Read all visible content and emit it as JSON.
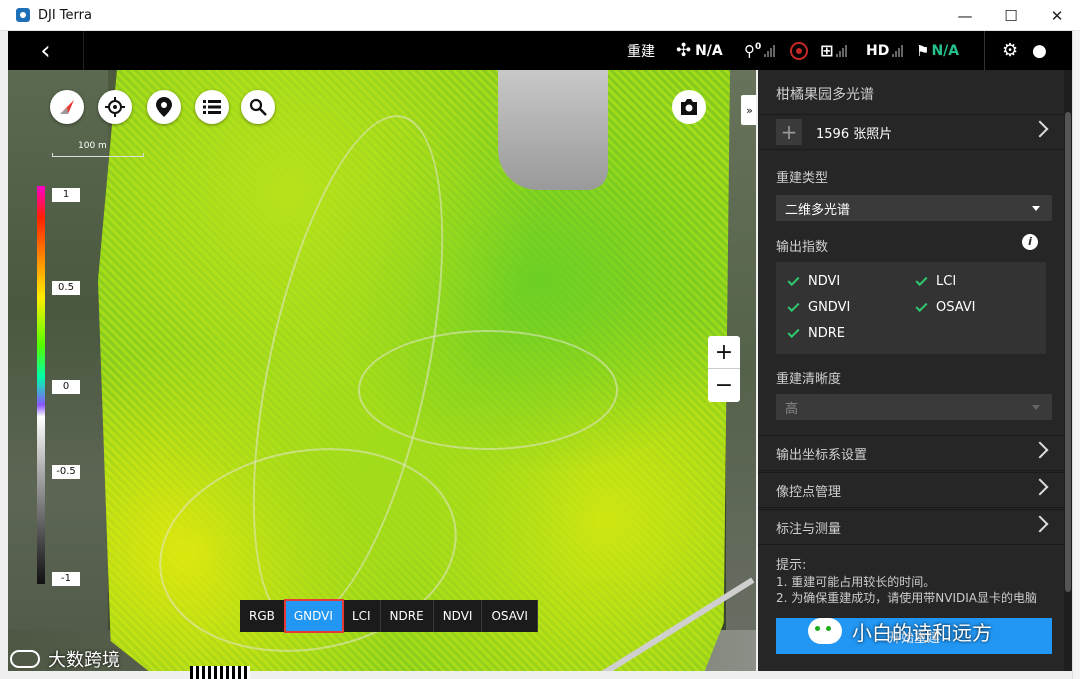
{
  "window": {
    "title": "DJI Terra",
    "controls": {
      "minimize": "—",
      "maximize": "☐",
      "close": "✕"
    }
  },
  "toolbar": {
    "back_icon": "‹",
    "rebuild_label": "重建",
    "aircraft_status": "N/A",
    "gps_count": "0",
    "hd_label": "HD",
    "rtk_status": "N/A"
  },
  "map": {
    "scale_label": "100 m",
    "legend": [
      "1",
      "0.5",
      "0",
      "-0.5",
      "-1"
    ],
    "index_tabs": [
      "RGB",
      "GNDVI",
      "LCI",
      "NDRE",
      "NDVI",
      "OSAVI"
    ],
    "active_index": "GNDVI",
    "zoom_in": "+",
    "zoom_out": "−",
    "collapse_icon": "»"
  },
  "panel": {
    "project_title": "柑橘果园多光谱",
    "photos": {
      "add_icon": "+",
      "label": "1596 张照片"
    },
    "rebuild_type": {
      "label": "重建类型",
      "value": "二维多光谱"
    },
    "output_index": {
      "label": "输出指数",
      "items": [
        "NDVI",
        "LCI",
        "GNDVI",
        "OSAVI",
        "NDRE"
      ]
    },
    "resolution": {
      "label": "重建清晰度",
      "value": "高"
    },
    "sections": [
      "输出坐标系设置",
      "像控点管理",
      "标注与测量"
    ],
    "tips": {
      "heading": "提示:",
      "line1": "1. 重建可能占用较长的时间。",
      "line2": "2. 为确保重建成功，请使用带NVIDIA显卡的电脑"
    },
    "start_button": "开始重建"
  },
  "watermarks": {
    "wechat": "小白的诗和远方",
    "bigdata": "大数跨境"
  },
  "colors": {
    "accent": "#2196f3",
    "ok_green": "#2ecc71",
    "status_green": "#24c18a",
    "highlight": "#e53935"
  }
}
